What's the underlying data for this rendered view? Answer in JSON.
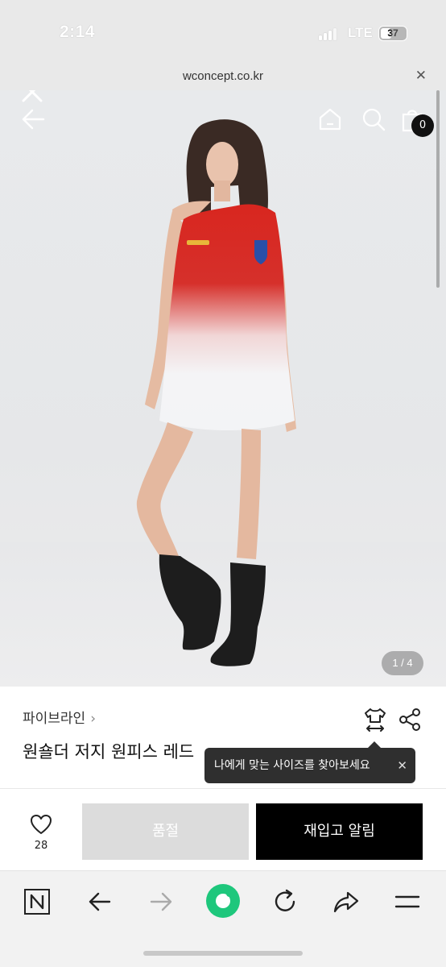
{
  "status_bar": {
    "time": "2:14",
    "network": "LTE",
    "battery": "37"
  },
  "url_bar": {
    "url": "wconcept.co.kr"
  },
  "hero": {
    "page_indicator": "1 / 4",
    "cart_count": "0",
    "image_page": 1,
    "image_total": 4
  },
  "product": {
    "brand": "파이브라인",
    "title": "원숄더 저지 원피스 레드",
    "size_tooltip": "나에게 맞는 사이즈를 찾아보세요"
  },
  "actions": {
    "like_count": "28",
    "soldout_label": "품절",
    "restock_label": "재입고 알림"
  },
  "icons": {
    "close": "close-icon",
    "back": "back-arrow-icon",
    "home": "home-icon",
    "search": "search-icon",
    "cart": "shopping-bag-icon",
    "size": "tshirt-size-icon",
    "share": "share-icon",
    "heart": "heart-icon",
    "naver": "naver-n-icon",
    "browser_home": "green-circle-home-icon",
    "refresh": "refresh-icon",
    "forward_share": "forward-share-icon",
    "menu": "menu-icon"
  },
  "colors": {
    "restock_bg": "#000000",
    "soldout_bg": "#dcdcdc",
    "tooltip_bg": "#2f2f2f",
    "accent_green": "#1ec77c"
  }
}
